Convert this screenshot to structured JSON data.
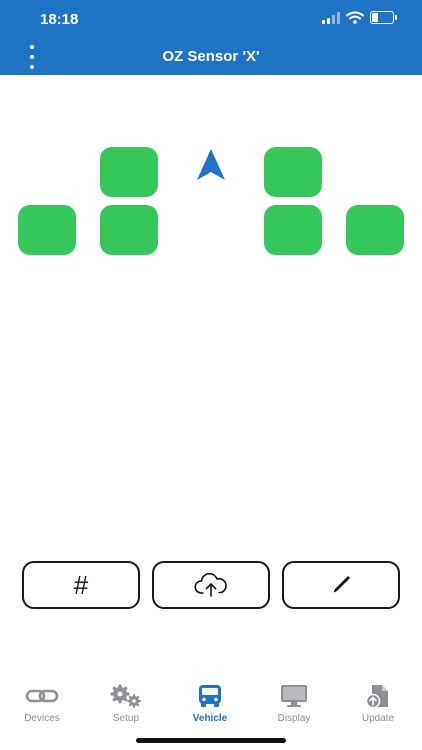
{
  "status_bar": {
    "time": "18:18"
  },
  "header": {
    "title": "OZ Sensor 'X'"
  },
  "actions": {
    "hash_symbol": "#"
  },
  "colors": {
    "header": "#1f73c4",
    "wheel_ok": "#35c759",
    "tab_active": "#1f73c4",
    "tab_inactive": "#8e8e93"
  },
  "tabs": [
    {
      "label": "Devices",
      "icon": "link-icon"
    },
    {
      "label": "Setup",
      "icon": "gears-icon"
    },
    {
      "label": "Vehicle",
      "icon": "bus-icon",
      "active": true
    },
    {
      "label": "Display",
      "icon": "monitor-icon"
    },
    {
      "label": "Update",
      "icon": "file-upload-icon"
    }
  ]
}
